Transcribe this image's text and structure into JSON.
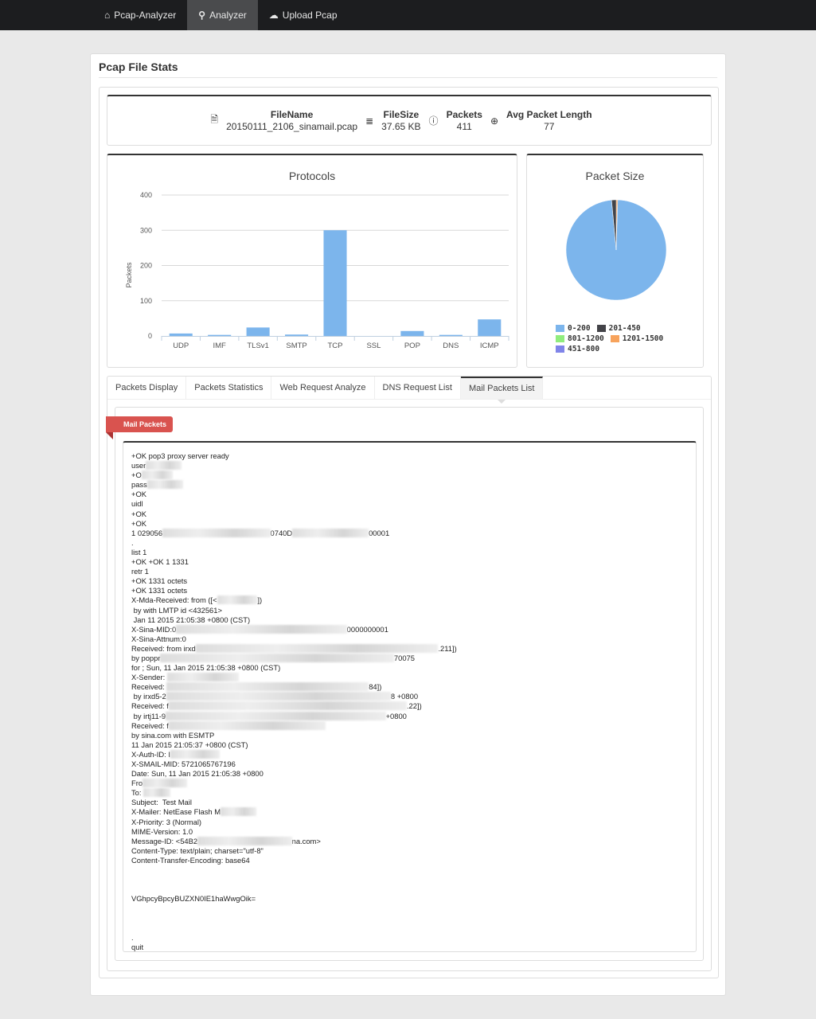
{
  "nav": {
    "items": [
      {
        "label": "Pcap-Analyzer",
        "icon": "home-icon"
      },
      {
        "label": "Analyzer",
        "icon": "search-icon",
        "active": true
      },
      {
        "label": "Upload Pcap",
        "icon": "cloud-upload-icon"
      }
    ]
  },
  "page": {
    "title": "Pcap File Stats"
  },
  "stats": [
    {
      "label": "FileName",
      "value": "20150111_2106_sinamail.pcap",
      "icon": "file-icon"
    },
    {
      "label": "FileSize",
      "value": "37.65 KB",
      "icon": "database-icon"
    },
    {
      "label": "Packets",
      "value": "411",
      "icon": "info-icon"
    },
    {
      "label": "Avg Packet Length",
      "value": "77",
      "icon": "zoom-in-icon"
    }
  ],
  "chart_data": [
    {
      "type": "bar",
      "title": "Protocols",
      "xlabel": "",
      "ylabel": "Packets",
      "categories": [
        "UDP",
        "IMF",
        "TLSv1",
        "SMTP",
        "TCP",
        "SSL",
        "POP",
        "DNS",
        "ICMP"
      ],
      "values": [
        7,
        3,
        24,
        4,
        300,
        0,
        14,
        3,
        47
      ],
      "ylim": [
        0,
        400
      ],
      "yticks": [
        0,
        100,
        200,
        300,
        400
      ],
      "grid": true,
      "color": "#7cb5ec"
    },
    {
      "type": "pie",
      "title": "Packet Size",
      "categories": [
        "0-200",
        "201-450",
        "801-1200",
        "1201-1500",
        "451-800"
      ],
      "values": [
        403,
        6,
        0,
        2,
        0
      ],
      "colors": [
        "#7cb5ec",
        "#434348",
        "#90ed7d",
        "#f7a35c",
        "#8085e9"
      ],
      "legend": "bottom"
    }
  ],
  "tabs": [
    {
      "label": "Packets Display"
    },
    {
      "label": "Packets Statistics"
    },
    {
      "label": "Web Request Analyze"
    },
    {
      "label": "DNS Request List"
    },
    {
      "label": "Mail Packets List",
      "active": true
    }
  ],
  "mail": {
    "ribbon": "Mail Packets",
    "lines": [
      [
        {
          "t": "+OK pop3 proxy server ready"
        }
      ],
      [
        {
          "t": "user"
        },
        {
          "r": "████████"
        }
      ],
      [
        {
          "t": "+O"
        },
        {
          "r": "███████"
        }
      ],
      [
        {
          "t": "pass"
        },
        {
          "r": "████████"
        }
      ],
      [
        {
          "t": "+OK"
        }
      ],
      [
        {
          "t": "uidl"
        }
      ],
      [
        {
          "t": "+OK"
        }
      ],
      [
        {
          "t": "+OK"
        }
      ],
      [
        {
          "t": "1 029056"
        },
        {
          "r": "████████████████████████"
        },
        {
          "t": "0740D"
        },
        {
          "r": "█████████████████"
        },
        {
          "t": "00001"
        }
      ],
      [
        {
          "t": "."
        }
      ],
      [
        {
          "t": "list 1"
        }
      ],
      [
        {
          "t": "+OK +OK 1 1331"
        }
      ],
      [
        {
          "t": "retr 1"
        }
      ],
      [
        {
          "t": "+OK 1331 octets"
        }
      ],
      [
        {
          "t": "+OK 1331 octets"
        }
      ],
      [
        {
          "t": "X-Mda-Received: from ([<"
        },
        {
          "r": "█████████"
        },
        {
          "t": "])"
        }
      ],
      [
        {
          "t": " by with LMTP id <432561>"
        }
      ],
      [
        {
          "t": " Jan 11 2015 21:05:38 +0800 (CST)"
        }
      ],
      [
        {
          "t": "X-Sina-MID:0"
        },
        {
          "r": "██████████████████████████████████████"
        },
        {
          "t": "0000000001"
        }
      ],
      [
        {
          "t": "X-Sina-Attnum:0"
        }
      ],
      [
        {
          "t": "Received: from irxd"
        },
        {
          "r": "██████████████████████████████████████████████████████"
        },
        {
          "t": ".211])"
        }
      ],
      [
        {
          "t": "by poppr"
        },
        {
          "r": "████████████████████████████████████████████████████"
        },
        {
          "t": "70075"
        }
      ],
      [
        {
          "t": "for ; Sun, 11 Jan 2015 21:05:38 +0800 (CST)"
        }
      ],
      [
        {
          "t": "X-Sender: "
        },
        {
          "r": "████████████████"
        }
      ],
      [
        {
          "t": "Received: "
        },
        {
          "r": "█████████████████████████████████████████████"
        },
        {
          "t": "84])"
        }
      ],
      [
        {
          "t": " by irxd5-2"
        },
        {
          "r": "██████████████████████████████████████████████████"
        },
        {
          "t": "8 +0800"
        }
      ],
      [
        {
          "t": "Received: f"
        },
        {
          "r": "█████████████████████████████████████████████████████"
        },
        {
          "t": ".22])"
        }
      ],
      [
        {
          "t": " by irtj11-9"
        },
        {
          "r": "█████████████████████████████████████████████████"
        },
        {
          "t": "+0800"
        }
      ],
      [
        {
          "t": "Received: f"
        },
        {
          "r": "███████████████████████████████████"
        }
      ],
      [
        {
          "t": "by sina.com with ESMTP"
        }
      ],
      [
        {
          "t": "11 Jan 2015 21:05:37 +0800 (CST)"
        }
      ],
      [
        {
          "t": "X-Auth-ID: I"
        },
        {
          "r": "███████████"
        }
      ],
      [
        {
          "t": "X-SMAIL-MID: 5721065767196"
        }
      ],
      [
        {
          "t": "Date: Sun, 11 Jan 2015 21:05:38 +0800"
        }
      ],
      [
        {
          "t": "Fro"
        },
        {
          "r": "██████████"
        }
      ],
      [
        {
          "t": "To: "
        },
        {
          "r": "██████"
        }
      ],
      [
        {
          "t": "Subject:  Test Mail"
        }
      ],
      [
        {
          "t": "X-Mailer: NetEase Flash M"
        },
        {
          "r": "████████"
        }
      ],
      [
        {
          "t": "X-Priority: 3 (Normal)"
        }
      ],
      [
        {
          "t": "MIME-Version: 1.0"
        }
      ],
      [
        {
          "t": "Message-ID: <54B2"
        },
        {
          "r": "█████████████████████"
        },
        {
          "t": "na.com>"
        }
      ],
      [
        {
          "t": "Content-Type: text/plain; charset=\"utf-8\""
        }
      ],
      [
        {
          "t": "Content-Transfer-Encoding: base64"
        }
      ],
      [
        {
          "t": ""
        }
      ],
      [
        {
          "t": ""
        }
      ],
      [
        {
          "t": ""
        }
      ],
      [
        {
          "t": "VGhpcyBpcyBUZXN0IE1haWwgOik="
        }
      ],
      [
        {
          "t": ""
        }
      ],
      [
        {
          "t": ""
        }
      ],
      [
        {
          "t": ""
        }
      ],
      [
        {
          "t": "."
        }
      ],
      [
        {
          "t": "quit"
        }
      ]
    ]
  }
}
